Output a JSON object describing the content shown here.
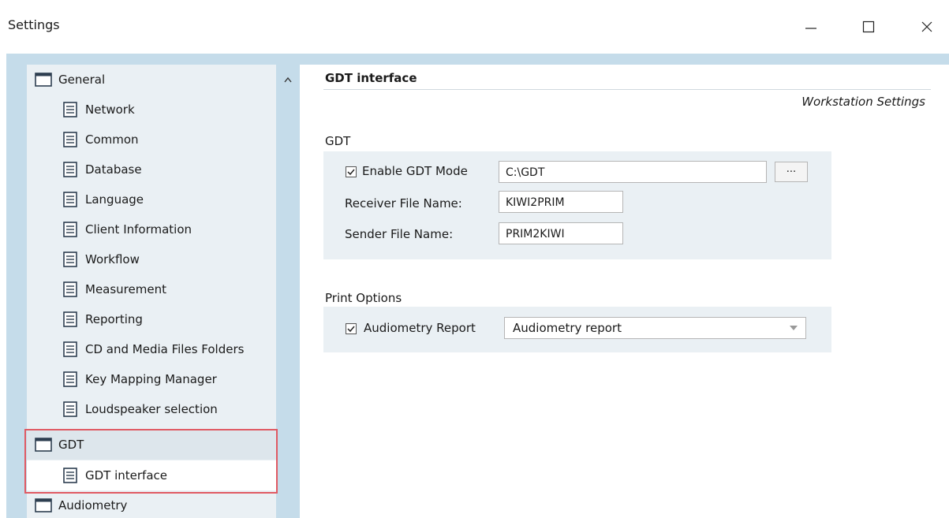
{
  "window": {
    "title": "Settings",
    "controls": {
      "minimize": "minimize-icon",
      "maximize": "maximize-icon",
      "close": "close-icon"
    }
  },
  "tree": {
    "items": [
      {
        "label": "General",
        "level": 0,
        "icon": "folder-icon"
      },
      {
        "label": "Network",
        "level": 1,
        "icon": "page-icon"
      },
      {
        "label": "Common",
        "level": 1,
        "icon": "page-icon"
      },
      {
        "label": "Database",
        "level": 1,
        "icon": "page-icon"
      },
      {
        "label": "Language",
        "level": 1,
        "icon": "page-icon"
      },
      {
        "label": "Client Information",
        "level": 1,
        "icon": "page-icon"
      },
      {
        "label": "Workflow",
        "level": 1,
        "icon": "page-icon"
      },
      {
        "label": "Measurement",
        "level": 1,
        "icon": "page-icon"
      },
      {
        "label": "Reporting",
        "level": 1,
        "icon": "page-icon"
      },
      {
        "label": "CD and Media Files Folders",
        "level": 1,
        "icon": "page-icon"
      },
      {
        "label": "Key Mapping Manager",
        "level": 1,
        "icon": "page-icon"
      },
      {
        "label": "Loudspeaker selection",
        "level": 1,
        "icon": "page-icon"
      },
      {
        "label": "GDT",
        "level": 0,
        "icon": "folder-icon"
      },
      {
        "label": "GDT interface",
        "level": 1,
        "icon": "page-icon",
        "selected": true
      },
      {
        "label": "Audiometry",
        "level": 0,
        "icon": "folder-icon"
      }
    ]
  },
  "panel": {
    "title": "GDT interface",
    "scope": "Workstation Settings",
    "gdt_section": {
      "label": "GDT",
      "enable_label": "Enable GDT Mode",
      "enable_checked": true,
      "path_value": "C:\\GDT",
      "browse_label": "...",
      "receiver_label": "Receiver File Name:",
      "receiver_value": "KIWI2PRIM",
      "sender_label": "Sender File Name:",
      "sender_value": "PRIM2KIWI"
    },
    "print_section": {
      "label": "Print Options",
      "audiometry_label": "Audiometry Report",
      "audiometry_checked": true,
      "report_selected": "Audiometry report"
    }
  },
  "colors": {
    "frame": "#c5dcea",
    "tree_bg": "#eaf0f4",
    "highlight_border": "#e05a63",
    "group_bg": "#eaf0f4"
  }
}
